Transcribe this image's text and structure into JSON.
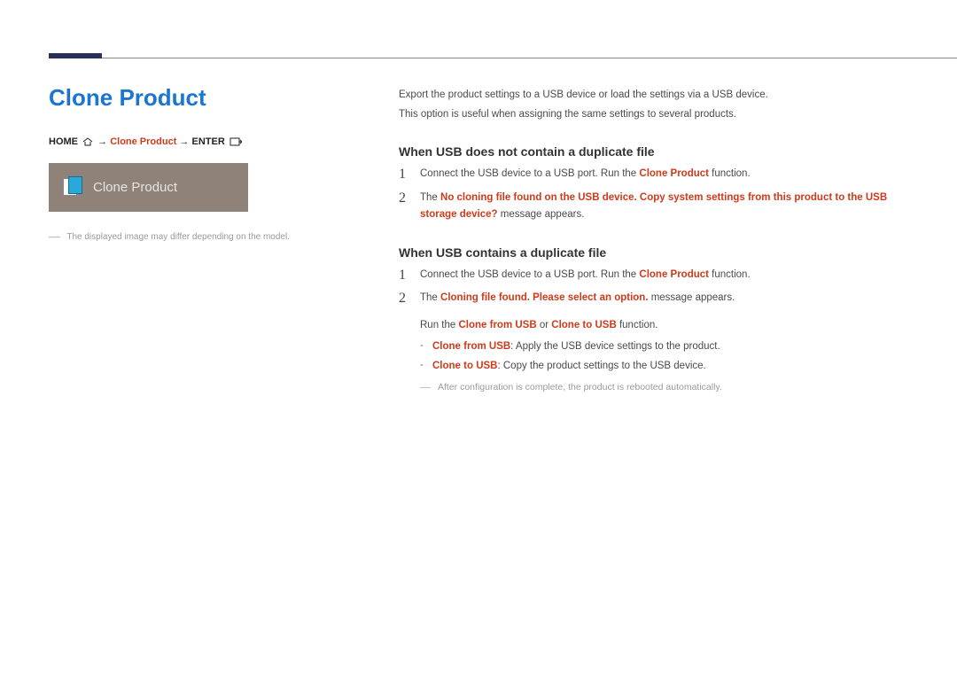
{
  "title": "Clone Product",
  "breadcrumb": {
    "home": "HOME",
    "arrow": "→",
    "mid": "Clone Product",
    "enter": "ENTER"
  },
  "card": {
    "label": "Clone Product"
  },
  "leftNote": "The displayed image may differ depending on the model.",
  "intro": {
    "line1": "Export the product settings to a USB device or load the settings via a USB device.",
    "line2": "This option is useful when assigning the same settings to several products."
  },
  "sectionA": {
    "heading": "When USB does not contain a duplicate file",
    "step1_a": "Connect the USB device to a USB port. Run the ",
    "step1_b": "Clone Product",
    "step1_c": " function.",
    "step2_a": "The ",
    "step2_b": "No cloning file found on the USB device. Copy system settings from this product to the USB storage device?",
    "step2_c": " message appears."
  },
  "sectionB": {
    "heading": "When USB contains a duplicate file",
    "step1_a": "Connect the USB device to a USB port. Run the ",
    "step1_b": "Clone Product",
    "step1_c": " function.",
    "step2_a": "The ",
    "step2_b": "Cloning file found. Please select an option.",
    "step2_c": " message appears.",
    "run_a": "Run the ",
    "run_b": "Clone from USB",
    "run_or": " or ",
    "run_c": "Clone to USB",
    "run_d": " function.",
    "itemFrom_a": "Clone from USB",
    "itemFrom_b": ": Apply the USB device settings to the product.",
    "itemTo_a": "Clone to USB",
    "itemTo_b": ": Copy the product settings to the USB device.",
    "finalNote": "After configuration is complete, the product is rebooted automatically."
  },
  "nums": {
    "one": "1",
    "two": "2"
  },
  "dashes": {
    "long": "―",
    "short": "-"
  }
}
